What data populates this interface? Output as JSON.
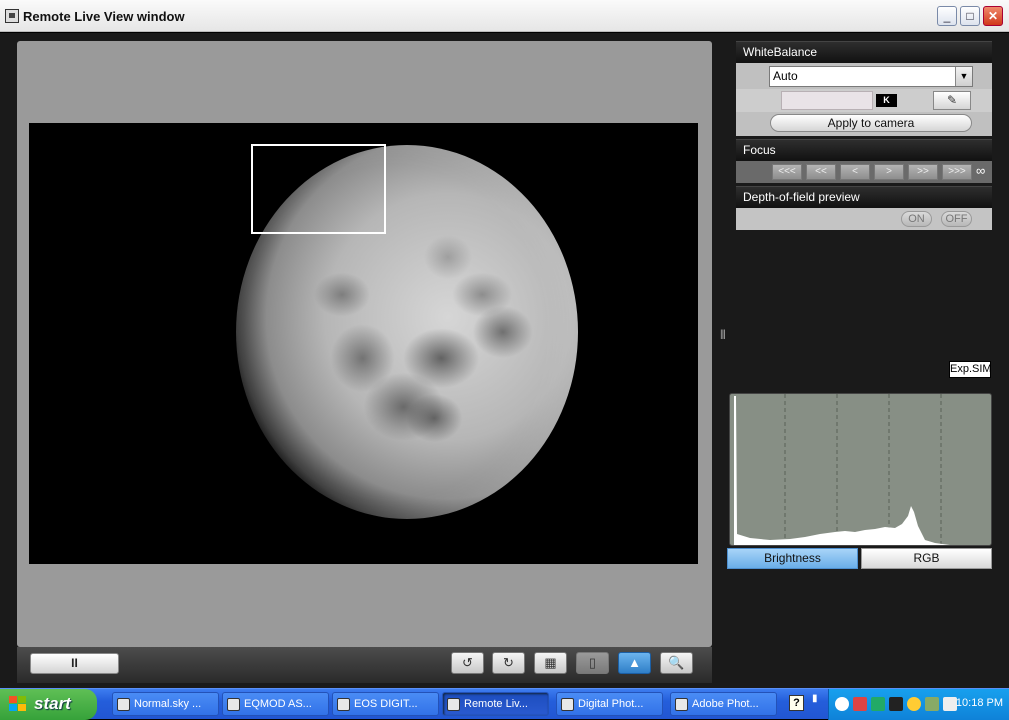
{
  "window": {
    "title": "Remote Live View window",
    "minimize": "_",
    "maximize": "□",
    "close": "✕"
  },
  "live_view": {
    "pause_label": "II",
    "toolbar": [
      {
        "name": "rotate-left-button",
        "label": "↺"
      },
      {
        "name": "rotate-right-button",
        "label": "↻"
      },
      {
        "name": "grid-button",
        "label": "▦"
      },
      {
        "name": "aspect-button",
        "label": "▯"
      },
      {
        "name": "image-view-button",
        "label": "▲"
      },
      {
        "name": "zoom-button",
        "label": "🔍"
      }
    ]
  },
  "white_balance": {
    "header": "WhiteBalance",
    "selected": "Auto",
    "k_badge": "K",
    "apply_label": "Apply to camera"
  },
  "focus": {
    "header": "Focus",
    "buttons": [
      "<<<",
      "<<",
      "<",
      ">",
      ">>",
      ">>>"
    ],
    "infinity": "∞"
  },
  "dof": {
    "header": "Depth-of-field preview",
    "on_label": "ON",
    "off_label": "OFF"
  },
  "exposure_sim_label": "Exp.SIM",
  "histogram": {
    "tabs": [
      {
        "label": "Brightness",
        "active": true
      },
      {
        "label": "RGB",
        "active": false
      }
    ]
  },
  "taskbar": {
    "start_label": "start",
    "tasks": [
      "Normal.sky ...",
      "EQMOD AS...",
      "EOS DIGIT...",
      "Remote Liv...",
      "Digital Phot...",
      "Adobe Phot..."
    ],
    "help_label": "?",
    "clock": "10:18 PM"
  },
  "colors": {
    "accent": "#6aaee8",
    "taskbar": "#245edb",
    "start": "#36a23a"
  }
}
